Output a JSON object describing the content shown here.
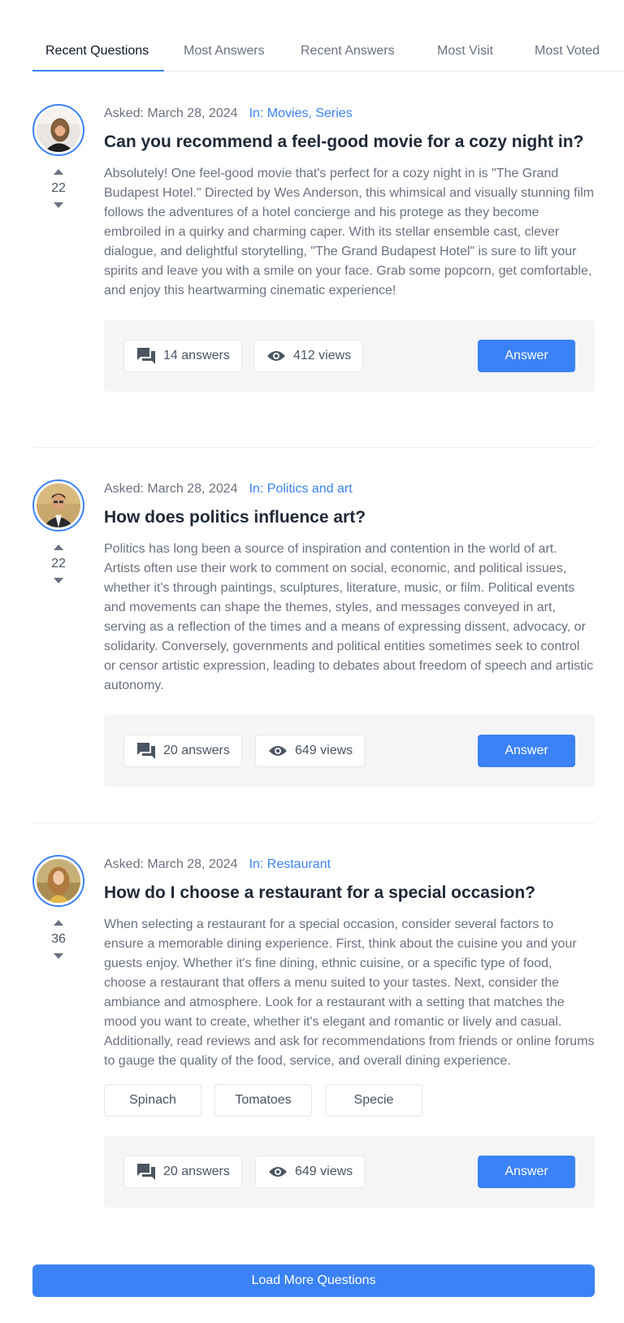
{
  "tabs": [
    {
      "label": "Recent Questions",
      "active": true
    },
    {
      "label": "Most Answers"
    },
    {
      "label": "Recent Answers"
    },
    {
      "label": "Most Visit"
    },
    {
      "label": "Most Voted"
    }
  ],
  "questions": [
    {
      "asked": "Asked: March 28, 2024",
      "category": "In: Movies, Series",
      "votes": "22",
      "title": "Can you recommend a feel-good movie for a cozy night in?",
      "text": "Absolutely! One feel-good movie that's perfect for a cozy night in is \"The Grand Budapest Hotel.\" Directed by Wes Anderson, this whimsical and visually stunning film follows the adventures of a hotel concierge and his protege as they become embroiled in a quirky and charming caper. With its stellar ensemble cast, clever dialogue, and delightful storytelling, \"The Grand Budapest Hotel\" is sure to lift your spirits and leave you with a smile on your face. Grab some popcorn, get comfortable, and enjoy this heartwarming cinematic experience!",
      "answers": "14 answers",
      "views": "412 views",
      "answer_label": "Answer"
    },
    {
      "asked": "Asked: March 28, 2024",
      "category": "In: Politics and art",
      "votes": "22",
      "title": "How does politics influence art?",
      "text": "Politics has long been a source of inspiration and contention in the world of art. Artists often use their work to comment on social, economic, and political issues, whether it's through paintings, sculptures, literature, music, or film. Political events and movements can shape the themes, styles, and messages conveyed in art, serving as a reflection of the times and a means of expressing dissent, advocacy, or solidarity. Conversely, governments and political entities sometimes seek to control or censor artistic expression, leading to debates about freedom of speech and artistic autonomy.",
      "answers": "20 answers",
      "views": "649 views",
      "answer_label": "Answer"
    },
    {
      "asked": "Asked: March 28, 2024",
      "category": "In: Restaurant",
      "votes": "36",
      "title": "How do I choose a restaurant for a special occasion?",
      "text": "When selecting a restaurant for a special occasion, consider several factors to ensure a memorable dining experience. First, think about the cuisine you and your guests enjoy. Whether it's fine dining, ethnic cuisine, or a specific type of food, choose a restaurant that offers a menu suited to your tastes. Next, consider the ambiance and atmosphere. Look for a restaurant with a setting that matches the mood you want to create, whether it's elegant and romantic or lively and casual. Additionally, read reviews and ask for recommendations from friends or online forums to gauge the quality of the food, service, and overall dining experience.",
      "tags": [
        "Spinach",
        "Tomatoes",
        "Specie"
      ],
      "answers": "20 answers",
      "views": "649 views",
      "answer_label": "Answer"
    }
  ],
  "load_more": "Load More Questions",
  "colors": {
    "accent": "#3b82f6",
    "muted_text": "#6b7280",
    "panel": "#f5f5f7"
  },
  "icons": {
    "answers": "chat-bubble-icon",
    "views": "eye-icon",
    "vote_up": "triangle-up-icon",
    "vote_down": "triangle-down-icon"
  }
}
